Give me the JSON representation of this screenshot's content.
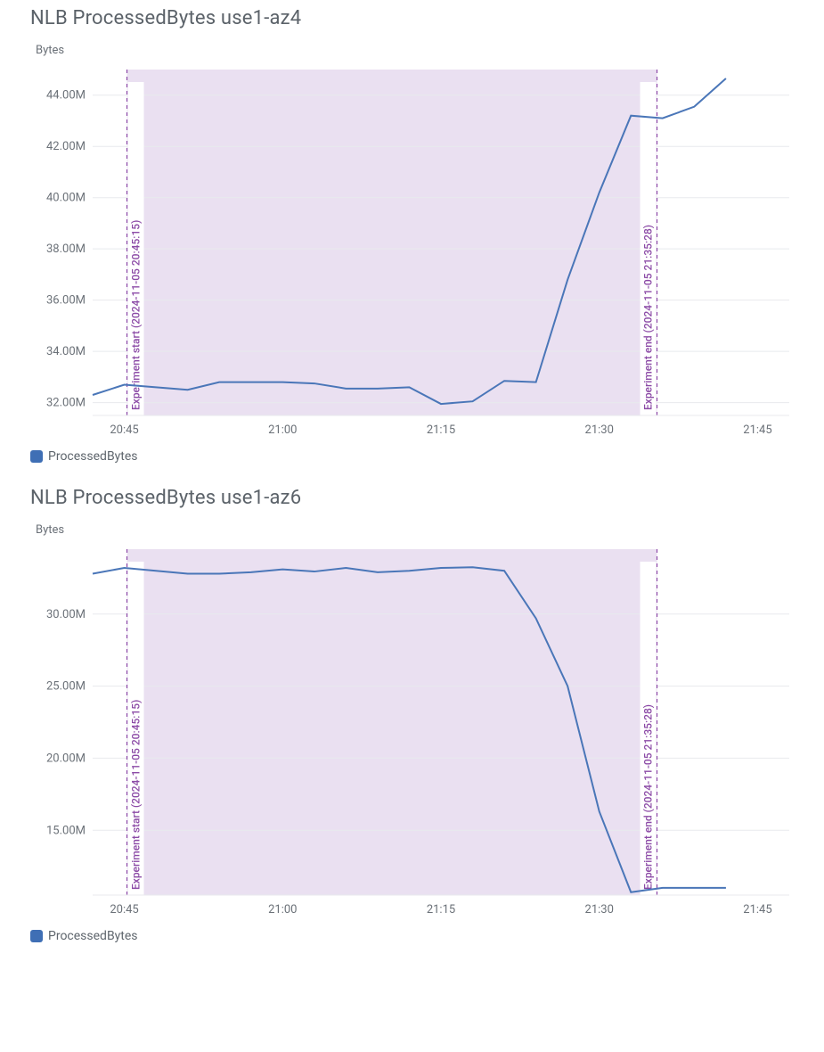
{
  "charts": [
    {
      "title": "NLB ProcessedBytes use1-az4",
      "ylabel": "Bytes",
      "legend": "ProcessedBytes",
      "annotations": {
        "start_label": "Experiment start (2024-11-05 20:45:15)",
        "end_label": "Experiment end (2024-11-05 21:35:28)"
      }
    },
    {
      "title": "NLB ProcessedBytes use1-az6",
      "ylabel": "Bytes",
      "legend": "ProcessedBytes",
      "annotations": {
        "start_label": "Experiment start (2024-11-05 20:45:15)",
        "end_label": "Experiment end (2024-11-05 21:35:28)"
      }
    }
  ],
  "chart_data": [
    {
      "type": "line",
      "title": "NLB ProcessedBytes use1-az4",
      "ylabel": "Bytes",
      "x_ticks": [
        "20:45",
        "21:00",
        "21:15",
        "21:30",
        "21:45"
      ],
      "y_ticks_labels": [
        "32.00M",
        "34.00M",
        "36.00M",
        "38.00M",
        "40.00M",
        "42.00M",
        "44.00M"
      ],
      "y_ticks_values": [
        32000000,
        34000000,
        36000000,
        38000000,
        40000000,
        42000000,
        44000000
      ],
      "xlim_minutes": [
        42,
        108
      ],
      "ylim": [
        31500000,
        45000000
      ],
      "shade_start_minute": 45.25,
      "shade_end_minute": 95.47,
      "annotations": {
        "start": {
          "minute": 45.25,
          "label": "Experiment start (2024-11-05 20:45:15)"
        },
        "end": {
          "minute": 95.47,
          "label": "Experiment end (2024-11-05 21:35:28)"
        }
      },
      "series": [
        {
          "name": "ProcessedBytes",
          "x_minutes": [
            42,
            45,
            48,
            51,
            54,
            57,
            60,
            63,
            66,
            69,
            72,
            75,
            78,
            81,
            84,
            87,
            90,
            93,
            96,
            99,
            102
          ],
          "y": [
            32300000,
            32700000,
            32600000,
            32500000,
            32800000,
            32800000,
            32800000,
            32750000,
            32550000,
            32550000,
            32600000,
            31950000,
            32050000,
            32850000,
            32800000,
            36800000,
            40200000,
            43200000,
            43100000,
            43550000,
            44650000
          ]
        }
      ]
    },
    {
      "type": "line",
      "title": "NLB ProcessedBytes use1-az6",
      "ylabel": "Bytes",
      "x_ticks": [
        "20:45",
        "21:00",
        "21:15",
        "21:30",
        "21:45"
      ],
      "y_ticks_labels": [
        "15.00M",
        "20.00M",
        "25.00M",
        "30.00M"
      ],
      "y_ticks_values": [
        15000000,
        20000000,
        25000000,
        30000000
      ],
      "xlim_minutes": [
        42,
        108
      ],
      "ylim": [
        10500000,
        34500000
      ],
      "shade_start_minute": 45.25,
      "shade_end_minute": 95.47,
      "annotations": {
        "start": {
          "minute": 45.25,
          "label": "Experiment start (2024-11-05 20:45:15)"
        },
        "end": {
          "minute": 95.47,
          "label": "Experiment end (2024-11-05 21:35:28)"
        }
      },
      "series": [
        {
          "name": "ProcessedBytes",
          "x_minutes": [
            42,
            45,
            48,
            51,
            54,
            57,
            60,
            63,
            66,
            69,
            72,
            75,
            78,
            81,
            84,
            87,
            90,
            93,
            96,
            99,
            102
          ],
          "y": [
            32800000,
            33200000,
            33000000,
            32800000,
            32800000,
            32900000,
            33100000,
            32950000,
            33200000,
            32900000,
            33000000,
            33200000,
            33250000,
            33000000,
            29700000,
            25000000,
            16300000,
            10700000,
            11000000,
            11000000,
            11000000
          ]
        }
      ]
    }
  ]
}
